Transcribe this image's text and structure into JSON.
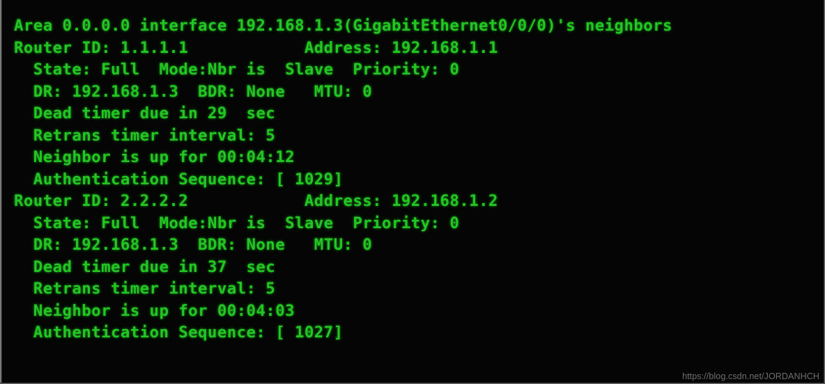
{
  "terminal": {
    "background_color": "#050505",
    "text_color": "#23c623",
    "lines": [
      "Area 0.0.0.0 interface 192.168.1.3(GigabitEthernet0/0/0)'s neighbors",
      "Router ID: 1.1.1.1            Address: 192.168.1.1",
      "  State: Full  Mode:Nbr is  Slave  Priority: 0",
      "  DR: 192.168.1.3  BDR: None   MTU: 0",
      "  Dead timer due in 29  sec",
      "  Retrans timer interval: 5",
      "  Neighbor is up for 00:04:12",
      "  Authentication Sequence: [ 1029]",
      "",
      "Router ID: 2.2.2.2            Address: 192.168.1.2",
      "  State: Full  Mode:Nbr is  Slave  Priority: 0",
      "  DR: 192.168.1.3  BDR: None   MTU: 0",
      "  Dead timer due in 37  sec",
      "  Retrans timer interval: 5",
      "  Neighbor is up for 00:04:03",
      "  Authentication Sequence: [ 1027]"
    ],
    "header": {
      "area": "0.0.0.0",
      "interface_address": "192.168.1.3",
      "interface_name": "GigabitEthernet0/0/0",
      "suffix": "'s neighbors"
    },
    "neighbors": [
      {
        "router_id": "1.1.1.1",
        "address": "192.168.1.1",
        "state": "Full",
        "mode": "Nbr is  Slave",
        "priority": "0",
        "dr": "192.168.1.3",
        "bdr": "None",
        "mtu": "0",
        "dead_timer_sec": "29",
        "retrans_timer_interval": "5",
        "neighbor_up_for": "00:04:12",
        "authentication_sequence": "[ 1029]"
      },
      {
        "router_id": "2.2.2.2",
        "address": "192.168.1.2",
        "state": "Full",
        "mode": "Nbr is  Slave",
        "priority": "0",
        "dr": "192.168.1.3",
        "bdr": "None",
        "mtu": "0",
        "dead_timer_sec": "37",
        "retrans_timer_interval": "5",
        "neighbor_up_for": "00:04:03",
        "authentication_sequence": "[ 1027]"
      }
    ]
  },
  "watermark": {
    "text": "https://blog.csdn.net/JORDANHCH"
  }
}
